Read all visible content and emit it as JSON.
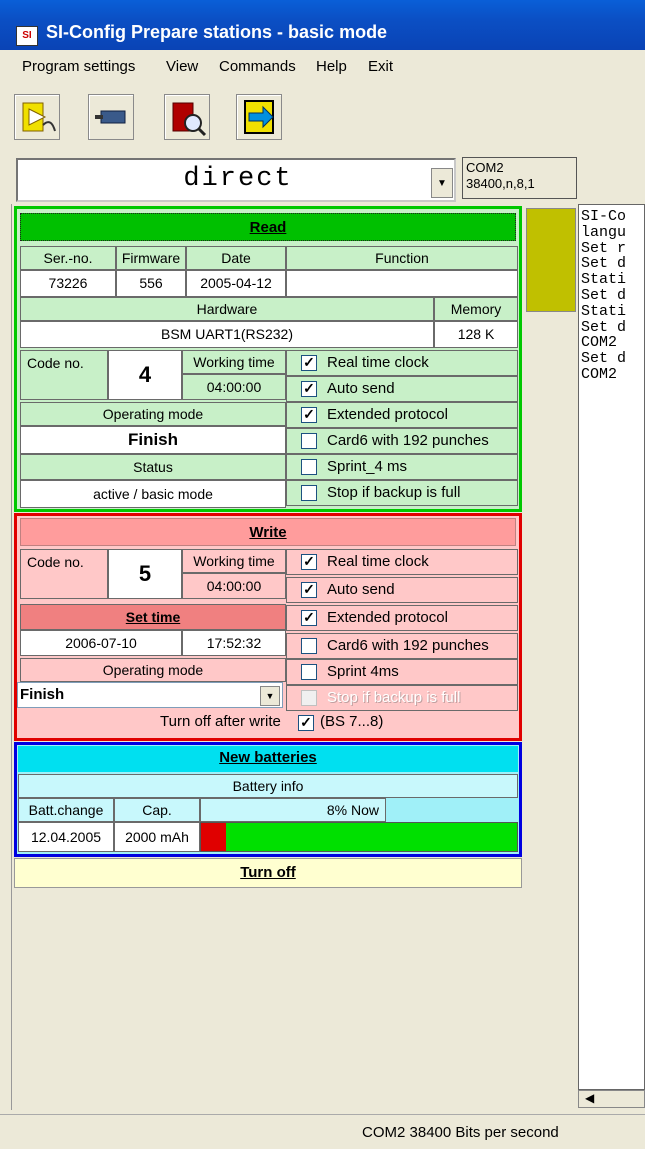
{
  "window": {
    "title": "SI-Config Prepare stations - basic mode",
    "icon_text": "SI"
  },
  "menu": [
    "Program settings",
    "View",
    "Commands",
    "Help",
    "Exit"
  ],
  "toolbar": {
    "icons": [
      "read-station-icon",
      "si-station-icon",
      "search-station-icon",
      "exit-icon"
    ]
  },
  "connection": {
    "mode": "direct",
    "com_port": "COM2",
    "com_settings": "38400,n,8,1"
  },
  "read": {
    "header": "Read",
    "columns": [
      "Ser.-no.",
      "Firmware",
      "Date",
      "Function"
    ],
    "values": [
      "73226",
      "556",
      "2005-04-12",
      ""
    ],
    "hardware_label": "Hardware",
    "memory_label": "Memory",
    "hardware": "BSM UART1(RS232)",
    "memory": "128 K",
    "code_no_label": "Code no.",
    "code_no": "4",
    "working_time_label": "Working time",
    "working_time": "04:00:00",
    "operating_mode_label": "Operating mode",
    "operating_mode": "Finish",
    "status_label": "Status",
    "status": "active / basic mode",
    "options": [
      {
        "label": "Real time clock",
        "checked": true
      },
      {
        "label": "Auto send",
        "checked": true
      },
      {
        "label": "Extended protocol",
        "checked": true
      },
      {
        "label": "Card6 with 192 punches",
        "checked": false
      },
      {
        "label": "Sprint_4 ms",
        "checked": false
      },
      {
        "label": "Stop if backup is full",
        "checked": false
      }
    ]
  },
  "write": {
    "header": "Write",
    "code_no_label": "Code no.",
    "code_no": "5",
    "working_time_label": "Working time",
    "working_time": "04:00:00",
    "set_time_label": "Set time",
    "date": "2006-07-10",
    "time": "17:52:32",
    "operating_mode_label": "Operating mode",
    "operating_mode": "Finish",
    "options": [
      {
        "label": "Real time clock",
        "checked": true,
        "enabled": true
      },
      {
        "label": "Auto send",
        "checked": true,
        "enabled": true
      },
      {
        "label": "Extended protocol",
        "checked": true,
        "enabled": true
      },
      {
        "label": "Card6 with 192 punches",
        "checked": false,
        "enabled": true
      },
      {
        "label": "Sprint 4ms",
        "checked": false,
        "enabled": true
      },
      {
        "label": "Stop if backup is full",
        "checked": false,
        "enabled": false
      }
    ],
    "turn_off_label": "Turn off after write",
    "turn_off_checked": true,
    "turn_off_suffix": "(BS 7...8)"
  },
  "batteries": {
    "header": "New batteries",
    "info_label": "Battery info",
    "batt_change_label": "Batt.change",
    "cap_label": "Cap.",
    "now_label": "8% Now",
    "batt_change": "12.04.2005",
    "cap": "2000 mAh",
    "level_percent": 8
  },
  "turn_off_button": "Turn off",
  "log_lines": [
    "SI-Co",
    "langu",
    "Set r",
    "Set d",
    "Stati",
    "Set d",
    "Stati",
    "Set d",
    "COM2",
    "Set d",
    "COM2"
  ],
  "statusbar": "COM2 38400 Bits per second",
  "colors": {
    "read": "#00c800",
    "write": "#e00000",
    "batteries": "#0000e0",
    "status_block": "#c0c000"
  }
}
